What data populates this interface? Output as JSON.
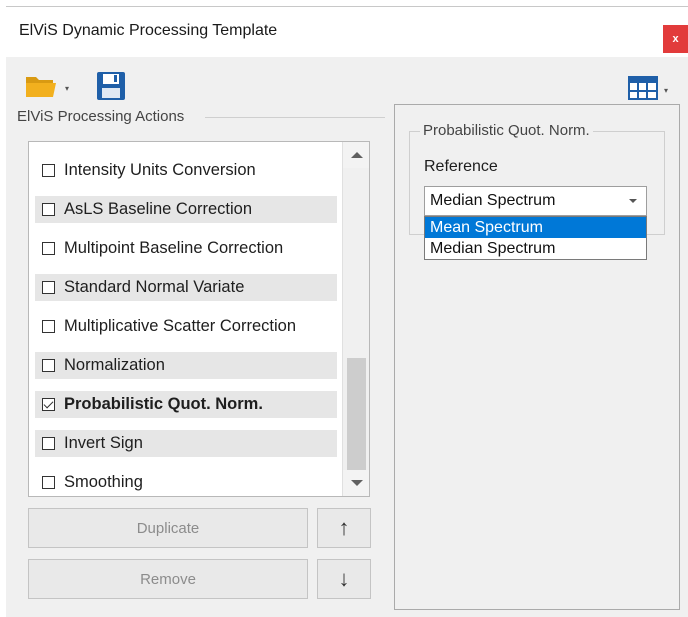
{
  "window": {
    "title": "ElViS Dynamic Processing Template",
    "close_label": "x"
  },
  "toolbar": {
    "open_icon": "folder-open-icon",
    "save_icon": "save-disk-icon",
    "columns_icon": "table-grid-icon",
    "colors": {
      "folder": "#f2b01e",
      "save": "#1f5fa8",
      "grid": "#1f5fa8"
    }
  },
  "actions_group": {
    "title": "ElViS Processing Actions",
    "items": [
      {
        "label": "Intensity Units Conversion",
        "checked": false
      },
      {
        "label": "AsLS Baseline Correction",
        "checked": false
      },
      {
        "label": "Multipoint Baseline Correction",
        "checked": false
      },
      {
        "label": "Standard Normal Variate",
        "checked": false
      },
      {
        "label": "Multiplicative Scatter Correction",
        "checked": false
      },
      {
        "label": "Normalization",
        "checked": false
      },
      {
        "label": "Probabilistic Quot. Norm.",
        "checked": true
      },
      {
        "label": "Invert Sign",
        "checked": false
      },
      {
        "label": "Smoothing",
        "checked": false
      }
    ],
    "duplicate_label": "Duplicate",
    "remove_label": "Remove",
    "move_up_label": "↑",
    "move_down_label": "↓"
  },
  "settings": {
    "group_title": "Probabilistic Quot. Norm.",
    "reference_label": "Reference",
    "reference_value": "Median Spectrum",
    "options": [
      "Mean Spectrum",
      "Median Spectrum"
    ],
    "highlighted_option": "Mean Spectrum",
    "accent": "#0078d7"
  }
}
